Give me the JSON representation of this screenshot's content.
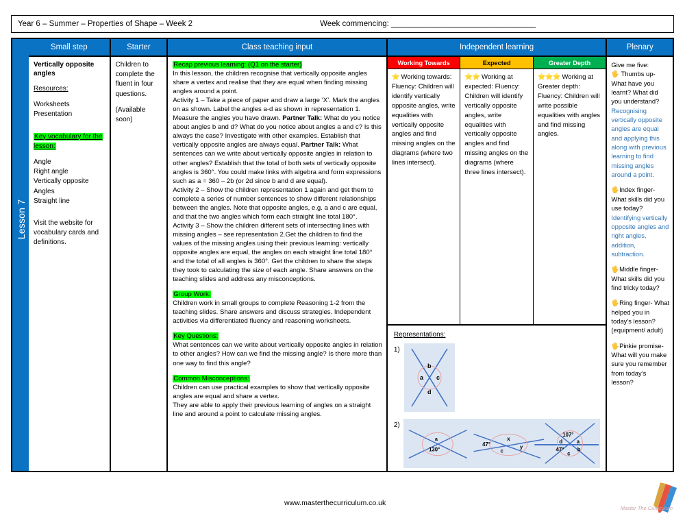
{
  "header": {
    "title": "Year 6 – Summer – Properties of Shape – Week 2",
    "week_commencing_label": "Week commencing: _________________________________"
  },
  "lesson_spine": {
    "label": "Lesson 7"
  },
  "columns": {
    "small_step": "Small step",
    "starter": "Starter",
    "class_teaching_input": "Class teaching input",
    "independent_learning": "Independent learning",
    "plenary": "Plenary"
  },
  "small_step": {
    "title": "Vertically opposite angles",
    "resources_heading": "Resources:",
    "resources": [
      "Worksheets",
      "Presentation"
    ],
    "vocab_heading": "Key vocabulary for the lesson:",
    "vocab": [
      "Angle",
      "Right angle",
      "Vertically opposite",
      "Angles",
      "Straight line"
    ],
    "footer_note": "Visit the website for vocabulary cards and definitions."
  },
  "starter": {
    "line1": "Children to complete the fluent in four questions.",
    "line2": "(Available soon)"
  },
  "class_teaching": {
    "recap_heading": "Recap previous learning: (Q1 on the starter)",
    "recap_body": "In this lesson, the children recognise that vertically opposite angles share a vertex and realise that they are equal when finding missing angles around a point.",
    "activity1_pre": "Activity 1 – Take a piece of paper and draw a large ‘X’. Mark the angles on as shown. Label the angles a-d as shown in representation 1. Measure the angles you have drawn. ",
    "partner_talk_1": "Partner Talk:",
    "activity1_mid": " What do you notice about angles b and d? What do you notice about angles a and c? Is this always the case? Investigate with other examples. Establish that vertically opposite angles are always equal. ",
    "partner_talk_2": "Partner Talk:",
    "activity1_end": " What sentences can we write about vertically opposite angles in relation to other angles? Establish that the total of both sets of vertically opposite angles is 360°. You could make links with algebra and form expressions such as a = 360 – 2b (or 2d since b and d are equal).",
    "activity2": "Activity 2 – Show the children representation 1 again and get them to complete a series of number sentences to show different relationships  between the angles. Note that opposite angles, e.g. a and c are equal, and that the two angles which form each straight line total 180°.",
    "activity3": "Activity 3 – Show the children different sets of intersecting lines with missing angles – see representation 2.Get the children to find the values of the missing angles using their previous learning: vertically opposite angles are equal, the angles on each straight line total 180° and the total of all angles is 360°. Get the children to share the steps they took to calculating the size of each angle. Share answers on the teaching slides and address any misconceptions.",
    "group_work_heading": "Group Work:",
    "group_work_body": "Children work in small groups to complete Reasoning 1-2 from the teaching slides. Share answers and discuss strategies. Independent activities via differentiated fluency and reasoning worksheets.",
    "key_questions_heading": "Key Questions:",
    "key_questions_body": "What sentences can we write about vertically opposite angles in relation to other angles? How can we find the missing angle? Is there more than one way to find this angle?",
    "misconceptions_heading": "Common Misconceptions:",
    "misconceptions_body1": "Children can use practical examples to show that vertically opposite angles are equal and share a vertex.",
    "misconceptions_body2": "They are able to apply their previous learning of angles on a straight line and around a point to calculate missing angles."
  },
  "independent": {
    "working_towards": {
      "header": "Working Towards",
      "stars": "⭐",
      "body": "Working towards: Fluency: Children will identify vertically opposite angles, write equalities with vertically opposite angles and find missing angles on the diagrams (where two lines intersect)."
    },
    "expected": {
      "header": "Expected",
      "stars": "⭐⭐",
      "body": "Working at expected: Fluency: Children will identify vertically opposite angles, write equalities with vertically opposite angles and find missing angles on the diagrams (where three lines intersect)."
    },
    "greater_depth": {
      "header": "Greater Depth",
      "stars": "⭐⭐⭐",
      "body": "Working at Greater depth: Fluency: Children will write possible equalities with angles and find missing angles."
    }
  },
  "representations": {
    "title": "Representations:",
    "item1_num": "1)",
    "item2_num": "2)",
    "diagram1_labels": [
      "a",
      "b",
      "c",
      "d"
    ],
    "diagram2a_labels": [
      "a",
      "130°"
    ],
    "diagram2b_labels": [
      "47°",
      "x",
      "y",
      "c"
    ],
    "diagram2c_labels": [
      "107°",
      "d",
      "a",
      "47°",
      "b",
      "c"
    ]
  },
  "plenary": {
    "intro": "Give me five:",
    "items": [
      {
        "hand": "🖐",
        "question": "Thumbs up- What have you learnt? What did you understand?",
        "answer": "Recognising vertically opposite angles are equal and applying this along with previous learning to find missing angles around a point."
      },
      {
        "hand": "🖐",
        "question": "Index finger- What skills did you use today?",
        "answer": "Identifying vertically opposite angles and right angles, addition, subtraction."
      },
      {
        "hand": "🖐",
        "question": "Middle finger- What skills did you find tricky today?",
        "answer": ""
      },
      {
        "hand": "🖐",
        "question": "Ring finger- What helped you in today’s lesson? (equipment/ adult)",
        "answer": ""
      },
      {
        "hand": "🖐",
        "question": "Pinkie promise- What will you make sure you remember from today’s lesson?",
        "answer": ""
      }
    ]
  },
  "footer": {
    "url": "www.masterthecurriculum.co.uk",
    "logo_text": "Master The Curriculum"
  },
  "colors": {
    "brand_blue": "#0a73c4",
    "working_towards": "#ff0000",
    "expected": "#ffc000",
    "greater_depth": "#00b050",
    "highlight": "#00ff00",
    "answer_blue": "#2e74b5",
    "diagram_bg": "#dce6f3",
    "diagram_line": "#4472c4",
    "diagram_circle": "#e8a0a0"
  }
}
